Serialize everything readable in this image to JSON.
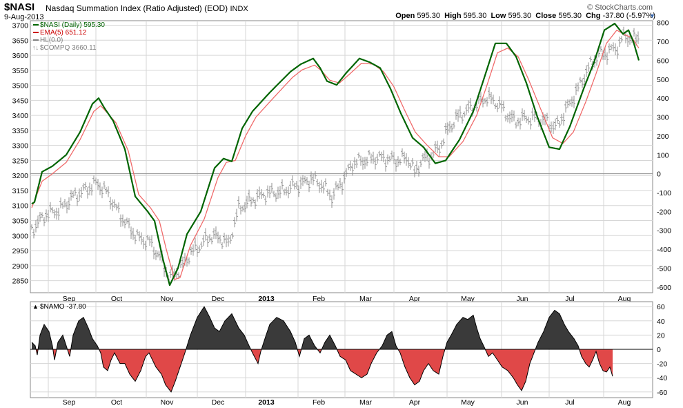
{
  "header": {
    "symbol": "$NASI",
    "description": "Nasdaq Summation Index (Ratio Adjusted) (EOD)",
    "exchange": "INDX",
    "date": "9-Aug-2013",
    "open_label": "Open",
    "open": "595.30",
    "high_label": "High",
    "high": "595.30",
    "low_label": "Low",
    "low": "595.30",
    "close_label": "Close",
    "close": "595.30",
    "chg_label": "Chg",
    "chg": "-37.80 (-5.97%)",
    "watermark": "© StockCharts.com"
  },
  "colors": {
    "nasi": "#006400",
    "ema": "#f06a6a",
    "compq": "#909090",
    "namo_pos": "#3a3a3a",
    "namo_neg": "#e04848",
    "grid": "#d6d6d6",
    "border": "#8a8a8a"
  },
  "chart_data": [
    {
      "type": "line",
      "panel": "main",
      "legend": [
        {
          "text": "$NASI (Daily) 595.30",
          "color": "#006400"
        },
        {
          "text": "EMA(5) 651.12",
          "color": "#cc0000"
        },
        {
          "text": "HL(0.0)",
          "color": "#808080"
        },
        {
          "text": "$COMPQ 3660.11",
          "color": "#808080"
        }
      ],
      "x_labels": [
        "Sep",
        "Oct",
        "Nov",
        "Dec",
        "2013",
        "Feb",
        "Mar",
        "Apr",
        "May",
        "Jun",
        "Jul",
        "Aug"
      ],
      "x_label_bold": "2013",
      "left_axis": {
        "ticks": [
          2850,
          2900,
          2950,
          3000,
          3050,
          3100,
          3150,
          3200,
          3250,
          3300,
          3350,
          3400,
          3450,
          3500,
          3550,
          3600,
          3650,
          3700
        ],
        "range": [
          2810,
          3715
        ]
      },
      "right_axis": {
        "ticks": [
          -600,
          -500,
          -400,
          -300,
          -200,
          -100,
          0,
          100,
          200,
          300,
          400,
          500,
          600,
          700,
          800
        ],
        "range": [
          -630,
          810
        ]
      },
      "nasi_keypoints": [
        [
          0,
          -160
        ],
        [
          4,
          -150
        ],
        [
          15,
          10
        ],
        [
          30,
          40
        ],
        [
          50,
          100
        ],
        [
          70,
          220
        ],
        [
          88,
          370
        ],
        [
          97,
          400
        ],
        [
          105,
          350
        ],
        [
          118,
          280
        ],
        [
          135,
          130
        ],
        [
          150,
          -120
        ],
        [
          168,
          -200
        ],
        [
          178,
          -250
        ],
        [
          190,
          -450
        ],
        [
          200,
          -590
        ],
        [
          212,
          -500
        ],
        [
          225,
          -320
        ],
        [
          245,
          -200
        ],
        [
          265,
          30
        ],
        [
          278,
          80
        ],
        [
          290,
          65
        ],
        [
          305,
          240
        ],
        [
          320,
          330
        ],
        [
          345,
          430
        ],
        [
          375,
          540
        ],
        [
          390,
          580
        ],
        [
          408,
          610
        ],
        [
          418,
          560
        ],
        [
          428,
          490
        ],
        [
          442,
          470
        ],
        [
          455,
          530
        ],
        [
          475,
          610
        ],
        [
          490,
          590
        ],
        [
          505,
          560
        ],
        [
          520,
          450
        ],
        [
          535,
          320
        ],
        [
          552,
          190
        ],
        [
          568,
          140
        ],
        [
          585,
          55
        ],
        [
          600,
          70
        ],
        [
          620,
          180
        ],
        [
          640,
          330
        ],
        [
          657,
          520
        ],
        [
          672,
          690
        ],
        [
          688,
          690
        ],
        [
          702,
          620
        ],
        [
          717,
          480
        ],
        [
          733,
          300
        ],
        [
          750,
          140
        ],
        [
          765,
          130
        ],
        [
          780,
          250
        ],
        [
          800,
          450
        ],
        [
          815,
          590
        ],
        [
          830,
          760
        ],
        [
          845,
          795
        ],
        [
          857,
          740
        ],
        [
          865,
          760
        ],
        [
          872,
          700
        ],
        [
          880,
          600
        ]
      ],
      "ema_keypoints": [
        [
          0,
          -180
        ],
        [
          15,
          -40
        ],
        [
          30,
          0
        ],
        [
          50,
          60
        ],
        [
          70,
          180
        ],
        [
          90,
          330
        ],
        [
          100,
          360
        ],
        [
          110,
          320
        ],
        [
          122,
          270
        ],
        [
          140,
          120
        ],
        [
          155,
          -110
        ],
        [
          172,
          -180
        ],
        [
          185,
          -250
        ],
        [
          195,
          -400
        ],
        [
          207,
          -560
        ],
        [
          215,
          -550
        ],
        [
          230,
          -380
        ],
        [
          250,
          -240
        ],
        [
          270,
          -20
        ],
        [
          282,
          60
        ],
        [
          295,
          70
        ],
        [
          310,
          200
        ],
        [
          325,
          300
        ],
        [
          350,
          400
        ],
        [
          378,
          510
        ],
        [
          392,
          550
        ],
        [
          410,
          575
        ],
        [
          420,
          545
        ],
        [
          432,
          495
        ],
        [
          446,
          480
        ],
        [
          460,
          525
        ],
        [
          478,
          585
        ],
        [
          495,
          580
        ],
        [
          510,
          540
        ],
        [
          525,
          460
        ],
        [
          540,
          340
        ],
        [
          556,
          220
        ],
        [
          572,
          155
        ],
        [
          590,
          90
        ],
        [
          605,
          90
        ],
        [
          625,
          170
        ],
        [
          645,
          310
        ],
        [
          660,
          470
        ],
        [
          675,
          640
        ],
        [
          690,
          665
        ],
        [
          705,
          620
        ],
        [
          720,
          500
        ],
        [
          738,
          340
        ],
        [
          755,
          190
        ],
        [
          770,
          160
        ],
        [
          785,
          220
        ],
        [
          803,
          380
        ],
        [
          818,
          530
        ],
        [
          833,
          690
        ],
        [
          848,
          760
        ],
        [
          860,
          735
        ],
        [
          870,
          720
        ],
        [
          880,
          665
        ]
      ],
      "compq_keypoints": [
        [
          0,
          3020
        ],
        [
          20,
          3070
        ],
        [
          40,
          3085
        ],
        [
          60,
          3130
        ],
        [
          80,
          3155
        ],
        [
          95,
          3175
        ],
        [
          110,
          3140
        ],
        [
          125,
          3080
        ],
        [
          140,
          3030
        ],
        [
          155,
          2990
        ],
        [
          170,
          2980
        ],
        [
          185,
          2930
        ],
        [
          200,
          2860
        ],
        [
          215,
          2890
        ],
        [
          230,
          2940
        ],
        [
          245,
          2970
        ],
        [
          260,
          3000
        ],
        [
          275,
          2990
        ],
        [
          285,
          2970
        ],
        [
          300,
          3090
        ],
        [
          320,
          3120
        ],
        [
          340,
          3140
        ],
        [
          360,
          3145
        ],
        [
          380,
          3165
        ],
        [
          395,
          3175
        ],
        [
          405,
          3190
        ],
        [
          420,
          3170
        ],
        [
          435,
          3130
        ],
        [
          450,
          3180
        ],
        [
          465,
          3240
        ],
        [
          480,
          3250
        ],
        [
          500,
          3260
        ],
        [
          515,
          3255
        ],
        [
          530,
          3250
        ],
        [
          545,
          3260
        ],
        [
          555,
          3210
        ],
        [
          565,
          3250
        ],
        [
          575,
          3260
        ],
        [
          590,
          3290
        ],
        [
          605,
          3360
        ],
        [
          620,
          3400
        ],
        [
          640,
          3430
        ],
        [
          660,
          3460
        ],
        [
          675,
          3440
        ],
        [
          690,
          3400
        ],
        [
          700,
          3380
        ],
        [
          715,
          3390
        ],
        [
          730,
          3390
        ],
        [
          745,
          3380
        ],
        [
          760,
          3360
        ],
        [
          775,
          3420
        ],
        [
          790,
          3480
        ],
        [
          805,
          3550
        ],
        [
          820,
          3600
        ],
        [
          835,
          3610
        ],
        [
          850,
          3630
        ],
        [
          860,
          3670
        ],
        [
          870,
          3650
        ],
        [
          880,
          3665
        ]
      ]
    },
    {
      "type": "area",
      "panel": "indicator",
      "legend": [
        {
          "text": "$NAMO -37.80",
          "color": "#000000"
        }
      ],
      "x_labels": [
        "Sep",
        "Oct",
        "Nov",
        "Dec",
        "2013",
        "Feb",
        "Mar",
        "Apr",
        "May",
        "Jun",
        "Jul",
        "Aug"
      ],
      "x_label_bold": "2013",
      "right_axis": {
        "ticks": [
          -60,
          -40,
          -20,
          0,
          20,
          40,
          60
        ],
        "range": [
          -68,
          67
        ]
      },
      "namo_keypoints": [
        [
          0,
          10
        ],
        [
          5,
          5
        ],
        [
          8,
          -8
        ],
        [
          12,
          20
        ],
        [
          18,
          35
        ],
        [
          25,
          25
        ],
        [
          30,
          5
        ],
        [
          33,
          -15
        ],
        [
          38,
          10
        ],
        [
          45,
          20
        ],
        [
          50,
          5
        ],
        [
          55,
          -10
        ],
        [
          60,
          20
        ],
        [
          68,
          40
        ],
        [
          75,
          45
        ],
        [
          82,
          30
        ],
        [
          88,
          15
        ],
        [
          95,
          5
        ],
        [
          100,
          -5
        ],
        [
          104,
          -25
        ],
        [
          110,
          -30
        ],
        [
          115,
          -15
        ],
        [
          120,
          -5
        ],
        [
          128,
          -20
        ],
        [
          135,
          -20
        ],
        [
          142,
          -35
        ],
        [
          150,
          -45
        ],
        [
          158,
          -30
        ],
        [
          165,
          -10
        ],
        [
          170,
          -5
        ],
        [
          180,
          -25
        ],
        [
          188,
          -35
        ],
        [
          194,
          -50
        ],
        [
          202,
          -60
        ],
        [
          208,
          -45
        ],
        [
          215,
          -25
        ],
        [
          222,
          -5
        ],
        [
          230,
          20
        ],
        [
          240,
          45
        ],
        [
          250,
          60
        ],
        [
          258,
          45
        ],
        [
          265,
          30
        ],
        [
          272,
          25
        ],
        [
          280,
          40
        ],
        [
          290,
          50
        ],
        [
          300,
          30
        ],
        [
          308,
          20
        ],
        [
          315,
          5
        ],
        [
          320,
          -5
        ],
        [
          328,
          -20
        ],
        [
          332,
          -3
        ],
        [
          338,
          15
        ],
        [
          345,
          35
        ],
        [
          355,
          45
        ],
        [
          365,
          40
        ],
        [
          375,
          25
        ],
        [
          382,
          10
        ],
        [
          388,
          -10
        ],
        [
          395,
          15
        ],
        [
          402,
          20
        ],
        [
          410,
          5
        ],
        [
          418,
          -5
        ],
        [
          425,
          10
        ],
        [
          432,
          20
        ],
        [
          440,
          5
        ],
        [
          447,
          -10
        ],
        [
          455,
          -15
        ],
        [
          462,
          -30
        ],
        [
          470,
          -35
        ],
        [
          478,
          -40
        ],
        [
          486,
          -35
        ],
        [
          492,
          -20
        ],
        [
          500,
          -5
        ],
        [
          508,
          5
        ],
        [
          515,
          20
        ],
        [
          522,
          25
        ],
        [
          528,
          5
        ],
        [
          534,
          -5
        ],
        [
          541,
          -25
        ],
        [
          548,
          -40
        ],
        [
          555,
          -50
        ],
        [
          562,
          -45
        ],
        [
          568,
          -30
        ],
        [
          575,
          -20
        ],
        [
          582,
          -30
        ],
        [
          590,
          -35
        ],
        [
          596,
          -10
        ],
        [
          602,
          10
        ],
        [
          608,
          20
        ],
        [
          616,
          35
        ],
        [
          625,
          45
        ],
        [
          632,
          42
        ],
        [
          640,
          48
        ],
        [
          645,
          30
        ],
        [
          650,
          15
        ],
        [
          655,
          5
        ],
        [
          662,
          -10
        ],
        [
          668,
          -5
        ],
        [
          675,
          -15
        ],
        [
          682,
          -25
        ],
        [
          690,
          -30
        ],
        [
          698,
          -40
        ],
        [
          704,
          -50
        ],
        [
          710,
          -58
        ],
        [
          716,
          -45
        ],
        [
          722,
          -20
        ],
        [
          728,
          -5
        ],
        [
          734,
          10
        ],
        [
          742,
          25
        ],
        [
          750,
          45
        ],
        [
          758,
          55
        ],
        [
          765,
          50
        ],
        [
          772,
          35
        ],
        [
          778,
          25
        ],
        [
          786,
          15
        ],
        [
          792,
          5
        ],
        [
          797,
          -10
        ],
        [
          803,
          -20
        ],
        [
          808,
          -25
        ],
        [
          813,
          -15
        ],
        [
          818,
          -3
        ],
        [
          823,
          -20
        ],
        [
          828,
          -30
        ],
        [
          833,
          -32
        ],
        [
          838,
          -25
        ],
        [
          842,
          -38
        ]
      ]
    }
  ]
}
